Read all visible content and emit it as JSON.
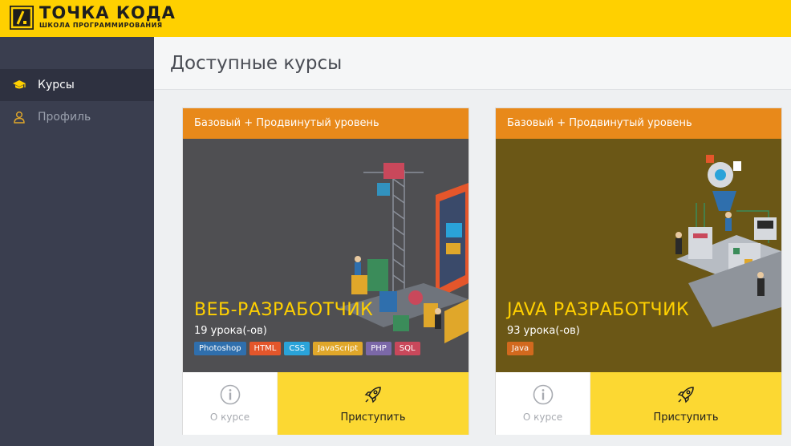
{
  "header": {
    "brand_title": "ТОЧКА КОДА",
    "brand_subtitle": "ШКОЛА ПРОГРАММИРОВАНИЯ",
    "logo_icon": "logo-mark-icon",
    "bg_color": "#ffd000"
  },
  "sidebar": {
    "items": [
      {
        "label": "Курсы",
        "icon": "graduation-cap-icon",
        "active": true
      },
      {
        "label": "Профиль",
        "icon": "user-icon",
        "active": false
      }
    ]
  },
  "main": {
    "title": "Доступные курсы"
  },
  "courses": [
    {
      "level": "Базовый + Продвинутый уровень",
      "name": "ВЕБ-РАЗРАБОТЧИК",
      "lessons": "19 урока(-ов)",
      "tags": [
        {
          "label": "Photoshop",
          "color": "#2f6fad"
        },
        {
          "label": "HTML",
          "color": "#e4562b"
        },
        {
          "label": "CSS",
          "color": "#2aa3d9"
        },
        {
          "label": "JavaScript",
          "color": "#e0a72a"
        },
        {
          "label": "PHP",
          "color": "#7b68a8"
        },
        {
          "label": "SQL",
          "color": "#c9485b"
        }
      ],
      "about_label": "О курсе",
      "start_label": "Приступить"
    },
    {
      "level": "Базовый + Продвинутый уровень",
      "name": "JAVA РАЗРАБОТЧИК",
      "lessons": "93 урока(-ов)",
      "tags": [
        {
          "label": "Java",
          "color": "#d2691e"
        }
      ],
      "about_label": "О курсе",
      "start_label": "Приступить"
    }
  ],
  "colors": {
    "accent": "#ffd000",
    "level_bar": "#e8891a",
    "start_button": "#fcd832",
    "sidebar": "#3a3e4f"
  }
}
